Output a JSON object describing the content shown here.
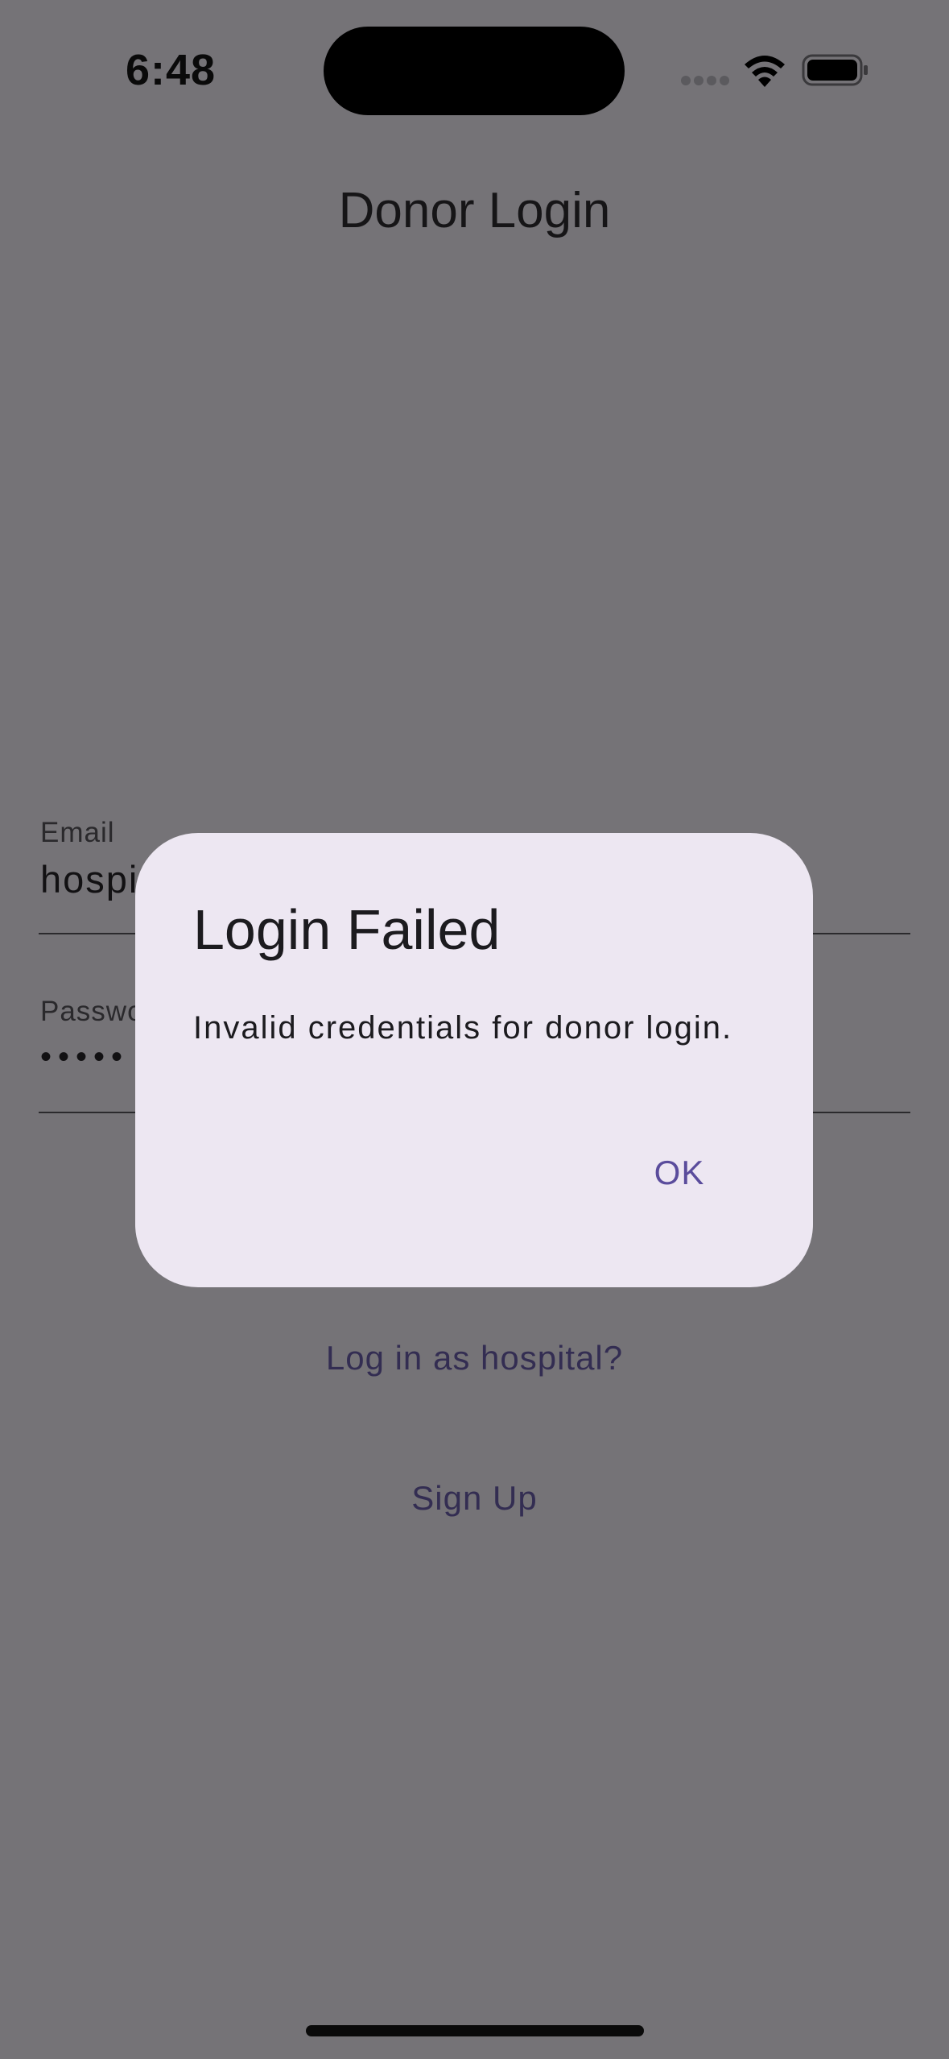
{
  "status_bar": {
    "time": "6:48"
  },
  "screen": {
    "title": "Donor Login",
    "email": {
      "label": "Email",
      "value": "hospi"
    },
    "password": {
      "label": "Passwo",
      "value": "•••••"
    },
    "link_hospital": "Log in as hospital?",
    "link_signup": "Sign Up"
  },
  "dialog": {
    "title": "Login Failed",
    "message": "Invalid credentials for donor login.",
    "ok_label": "OK"
  },
  "colors": {
    "scrim_background": "#757377",
    "dialog_surface": "#ede7f2",
    "accent": "#5a4c9c"
  }
}
